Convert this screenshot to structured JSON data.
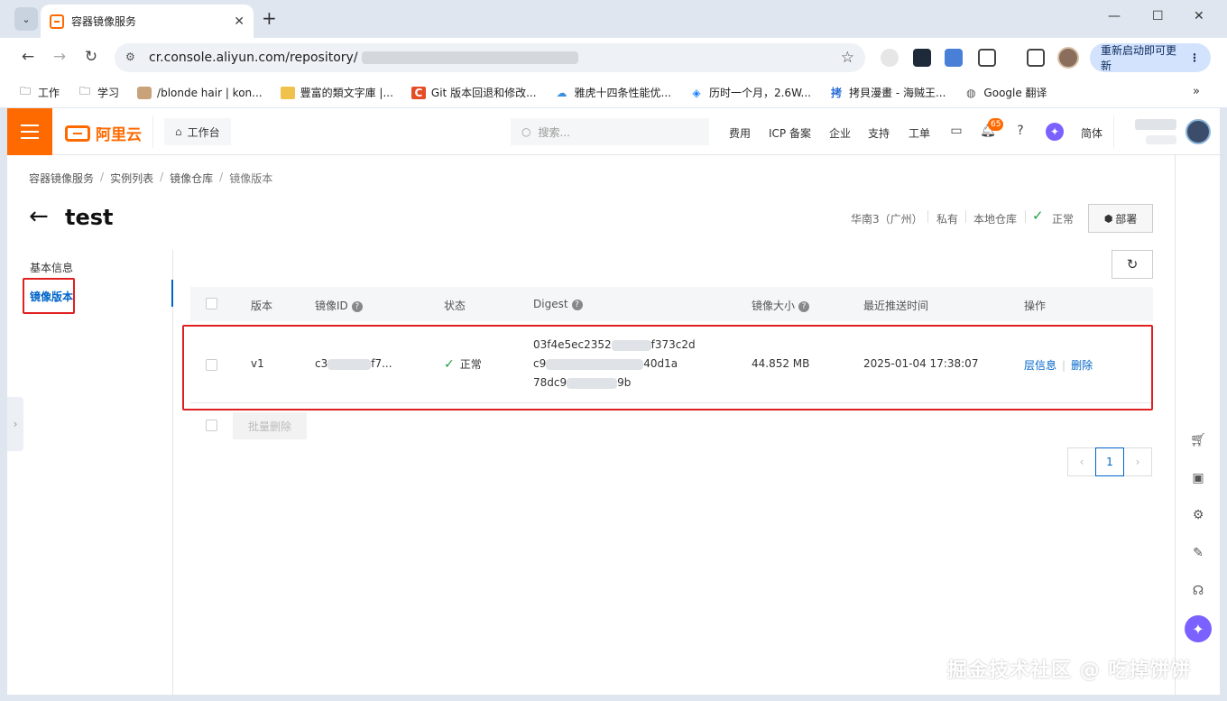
{
  "browser": {
    "tab_title": "容器镜像服务",
    "url": "cr.console.aliyun.com/repository/",
    "update_button": "重新启动即可更新",
    "bookmarks": [
      {
        "label": "工作",
        "icon": "folder-icon"
      },
      {
        "label": "学习",
        "icon": "folder-icon"
      },
      {
        "label": "/blonde hair | kon...",
        "icon": "image-favicon"
      },
      {
        "label": "豐富的類文字庫 |...",
        "icon": "doc-favicon"
      },
      {
        "label": "Git 版本回退和修改...",
        "icon": "c-favicon"
      },
      {
        "label": "雅虎十四条性能优...",
        "icon": "cloud-favicon"
      },
      {
        "label": "历时一个月，2.6W...",
        "icon": "juejin-favicon"
      },
      {
        "label": "拷貝漫畫 - 海贼王...",
        "icon": "kaobei-favicon"
      },
      {
        "label": "Google 翻译",
        "icon": "globe-icon"
      }
    ]
  },
  "console": {
    "logo_text": "阿里云",
    "workbench": "工作台",
    "search_placeholder": "搜索...",
    "nav": [
      "费用",
      "ICP 备案",
      "企业",
      "支持",
      "工单"
    ],
    "bell_badge": "65",
    "lang": "简体"
  },
  "breadcrumb": [
    "容器镜像服务",
    "实例列表",
    "镜像仓库",
    "镜像版本"
  ],
  "page": {
    "title": "test",
    "region": "华南3（广州）",
    "visibility": "私有",
    "repo_type": "本地仓库",
    "status": "正常",
    "deploy_button": "部署"
  },
  "side_menu": {
    "items": [
      "基本信息",
      "镜像版本"
    ],
    "active": "镜像版本"
  },
  "table": {
    "columns": [
      "版本",
      "镜像ID",
      "状态",
      "Digest",
      "镜像大小",
      "最近推送时间",
      "操作"
    ],
    "rows": [
      {
        "version": "v1",
        "image_id_prefix": "c3",
        "image_id_suffix": "f7...",
        "status": "正常",
        "digest_line1_a": "03f4e5ec2352",
        "digest_line1_b": "f373c2d",
        "digest_line2_a": "c9",
        "digest_line2_b": "40d1a",
        "digest_line3_a": "78dc9",
        "digest_line3_b": "9b",
        "size": "44.852 MB",
        "pushed_at": "2025-01-04 17:38:07",
        "action_layers": "层信息",
        "action_delete": "删除"
      }
    ],
    "batch_delete": "批量删除"
  },
  "pagination": {
    "current": "1"
  },
  "watermark": "掘金技术社区 @ 吃掉饼饼"
}
